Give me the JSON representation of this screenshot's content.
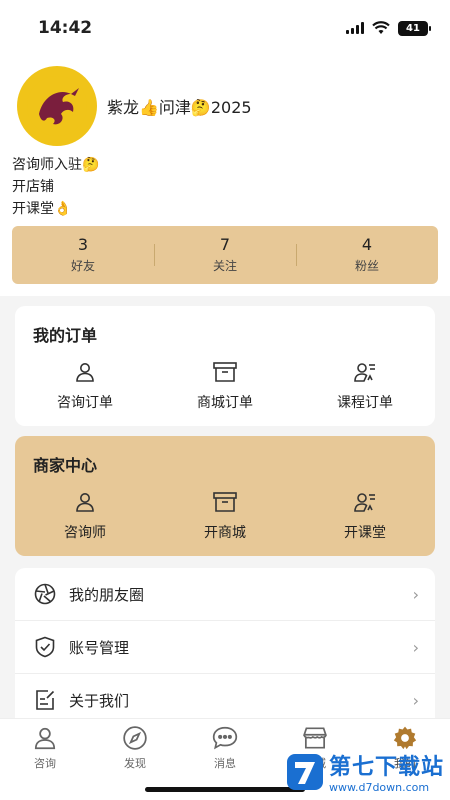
{
  "status_bar": {
    "time": "14:42",
    "battery": "41"
  },
  "profile": {
    "name": "紫龙👍问津🤔2025",
    "lines": [
      "咨询师入驻🤔",
      "开店铺",
      "开课堂👌"
    ]
  },
  "stats": [
    {
      "value": "3",
      "label": "好友"
    },
    {
      "value": "7",
      "label": "关注"
    },
    {
      "value": "4",
      "label": "粉丝"
    }
  ],
  "orders": {
    "title": "我的订单",
    "items": [
      {
        "label": "咨询订单",
        "icon": "user-icon"
      },
      {
        "label": "商城订单",
        "icon": "box-icon"
      },
      {
        "label": "课程订单",
        "icon": "user-list-icon"
      }
    ]
  },
  "merchant": {
    "title": "商家中心",
    "items": [
      {
        "label": "咨询师",
        "icon": "user-icon"
      },
      {
        "label": "开商城",
        "icon": "box-icon"
      },
      {
        "label": "开课堂",
        "icon": "user-list-icon"
      }
    ]
  },
  "menu": [
    {
      "label": "我的朋友圈",
      "icon": "aperture-icon"
    },
    {
      "label": "账号管理",
      "icon": "shield-check-icon"
    },
    {
      "label": "关于我们",
      "icon": "edit-doc-icon"
    }
  ],
  "tabbar": [
    {
      "label": "咨询",
      "icon": "person-icon"
    },
    {
      "label": "发现",
      "icon": "compass-icon"
    },
    {
      "label": "消息",
      "icon": "chat-icon"
    },
    {
      "label": "商城",
      "icon": "store-icon"
    },
    {
      "label": "我的",
      "icon": "gear-icon"
    }
  ],
  "watermark": {
    "title": "第七下载站",
    "url": "www.d7down.com"
  },
  "colors": {
    "accent": "#e7c897",
    "avatar_bg": "#f0c419",
    "watermark": "#1a6fd1"
  }
}
